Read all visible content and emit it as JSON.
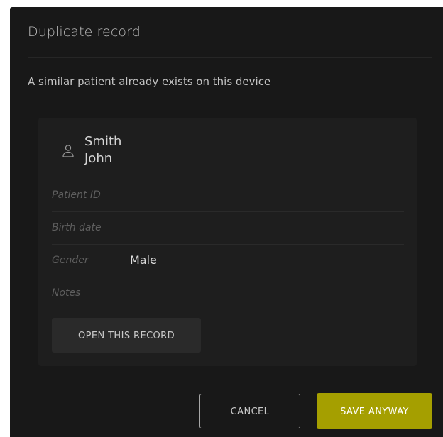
{
  "dialog": {
    "title": "Duplicate record",
    "message": "A similar patient already exists on this device"
  },
  "record": {
    "icon": "person-icon",
    "last_name": "Smith",
    "first_name": "John",
    "fields": [
      {
        "label": "Patient ID",
        "value": ""
      },
      {
        "label": "Birth date",
        "value": ""
      },
      {
        "label": "Gender",
        "value": "Male"
      },
      {
        "label": "Notes",
        "value": ""
      }
    ],
    "open_label": "OPEN THIS RECORD"
  },
  "actions": {
    "cancel_label": "CANCEL",
    "save_label": "SAVE ANYWAY"
  },
  "colors": {
    "dialog_bg": "#181818",
    "card_bg": "#1e1e1e",
    "accent": "#a59f00"
  }
}
